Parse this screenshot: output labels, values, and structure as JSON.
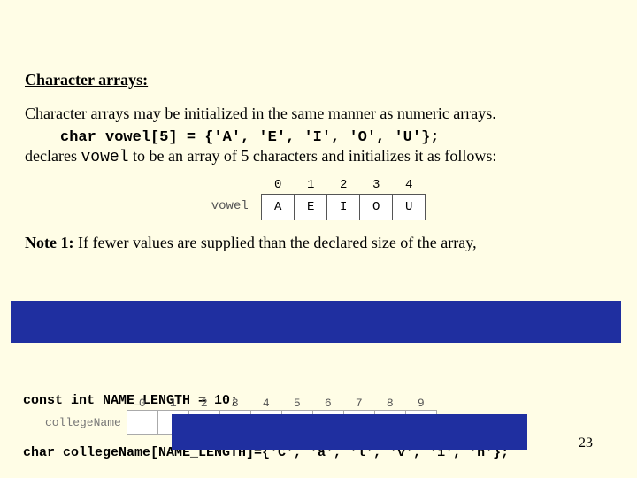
{
  "heading": "Character arrays:",
  "intro1_a": "Character arrays",
  "intro1_b": " may be initialized in the same manner as numeric arrays.",
  "code1": "char vowel[5] = {'A', 'E', 'I', 'O', 'U'};",
  "decl1_a": "declares ",
  "decl1_vowel": "vowel",
  "decl1_b": " to be an array of 5 characters and initializes it as follows:",
  "vowel_label": "vowel",
  "vowel_idx": [
    "0",
    "1",
    "2",
    "3",
    "4"
  ],
  "vowel_vals": [
    "A",
    "E",
    "I",
    "O",
    "U"
  ],
  "note1_label": "Note 1:  ",
  "note1_text": "If fewer values are supplied than the declared size of the array,",
  "code2_a": "const int NAME_LENGTH = 10;",
  "code2_b": "char collegeName[NAME_LENGTH]={'C', 'a', 'l', 'v', 'i', 'n'};",
  "college_label": "collegeName",
  "college_idx": [
    "0",
    "1",
    "2",
    "3",
    "4",
    "5",
    "6",
    "7",
    "8",
    "9"
  ],
  "page_number": "23"
}
